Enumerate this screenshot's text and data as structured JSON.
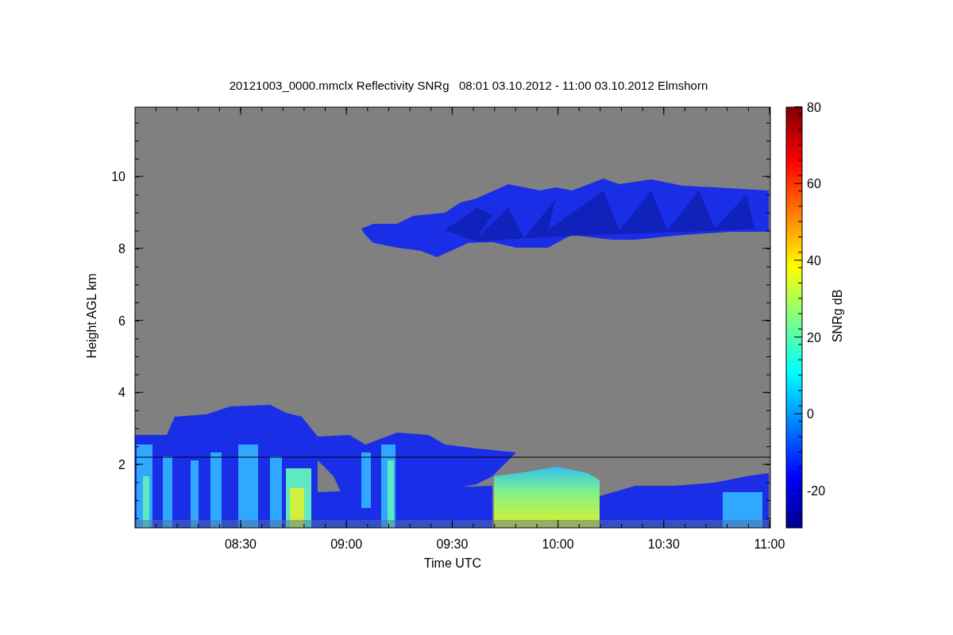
{
  "title": "20121003_0000.mmclx Reflectivity SNRg   08:01 03.10.2012 - 11:00 03.10.2012 Elmshorn",
  "y_axis": {
    "label": "Height AGL km",
    "ticks": [
      "10",
      "8",
      "6",
      "4",
      "2"
    ]
  },
  "x_axis": {
    "label": "Time UTC",
    "ticks": [
      "08:30",
      "09:00",
      "09:30",
      "10:00",
      "10:30",
      "11:00"
    ]
  },
  "colorbar": {
    "label": "SNRg dB",
    "ticks": [
      "80",
      "60",
      "40",
      "20",
      "0",
      "-20"
    ]
  }
}
